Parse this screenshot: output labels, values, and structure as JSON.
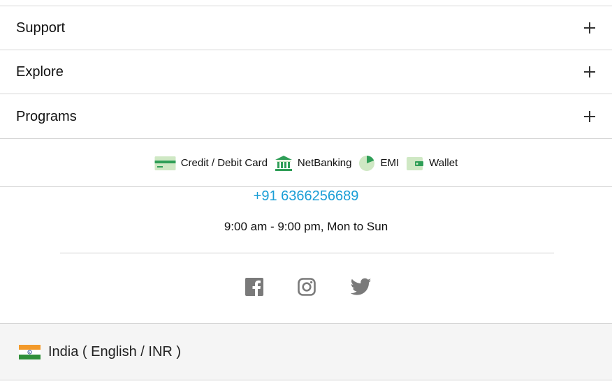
{
  "accordion": [
    {
      "label": "Support"
    },
    {
      "label": "Explore"
    },
    {
      "label": "Programs"
    }
  ],
  "payments": {
    "methods": [
      {
        "label": "Credit / Debit Card",
        "icon": "credit-card-icon"
      },
      {
        "label": "NetBanking",
        "icon": "bank-icon"
      },
      {
        "label": "EMI",
        "icon": "pie-chart-icon"
      },
      {
        "label": "Wallet",
        "icon": "wallet-icon"
      }
    ]
  },
  "contact": {
    "phone": "+91 6366256689",
    "hours": "9:00 am - 9:00 pm, Mon to Sun"
  },
  "social": [
    "facebook-icon",
    "instagram-icon",
    "twitter-icon"
  ],
  "locale": {
    "label": "India ( English / INR )",
    "flag": "india-flag-icon"
  },
  "colors": {
    "link": "#1a9ed6",
    "icon_green": "#2f9e57",
    "icon_green_light": "#cfe8c4",
    "social_gray": "#7a7a7a",
    "footer_bg": "#f5f5f5"
  }
}
